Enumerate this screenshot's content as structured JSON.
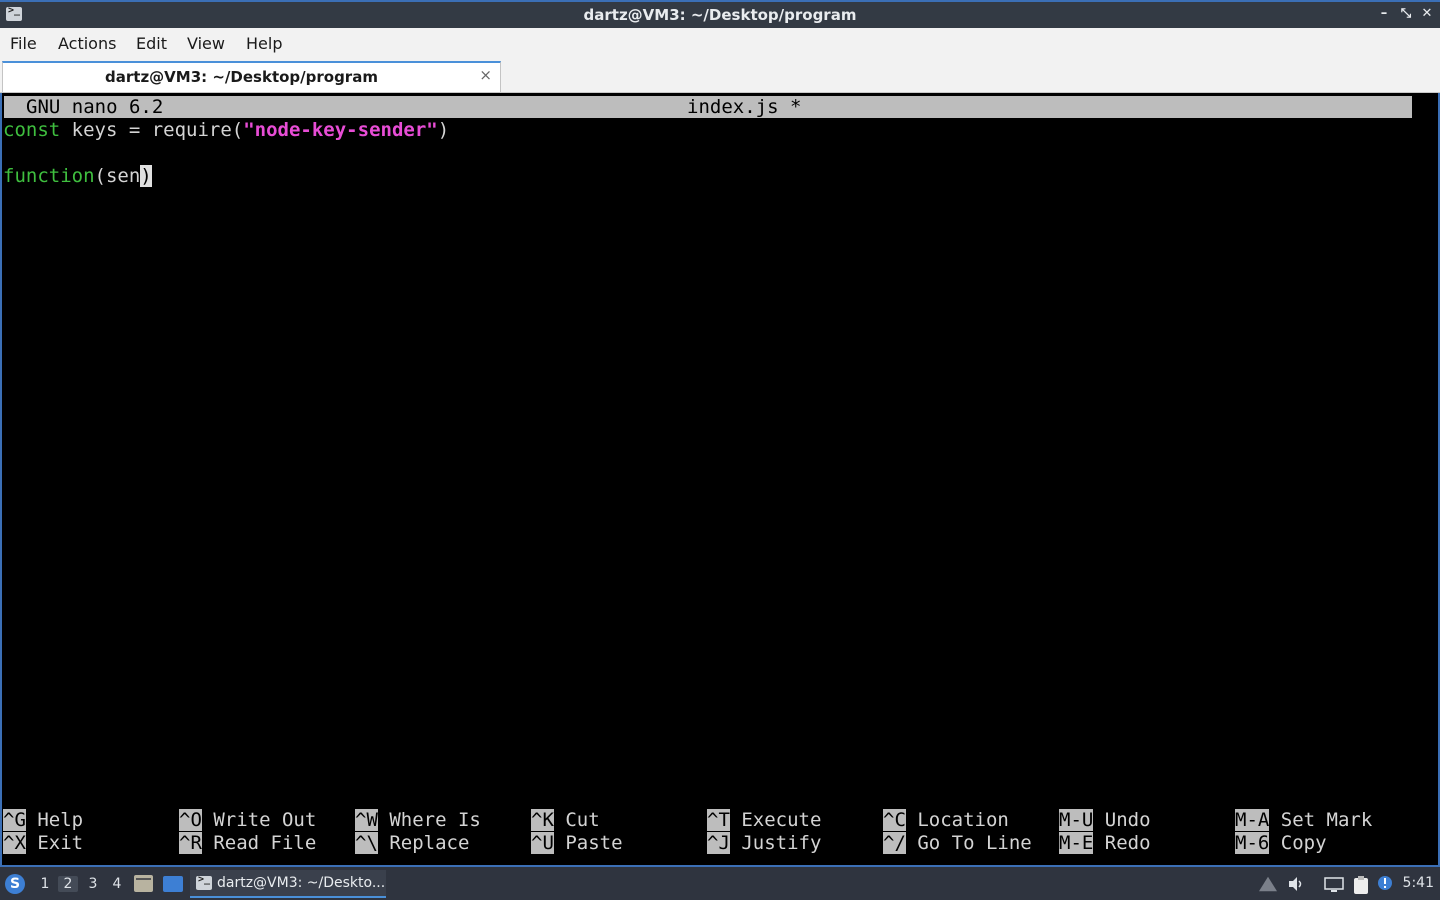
{
  "window": {
    "title": "dartz@VM3: ~/Desktop/program",
    "icon": "terminal-icon",
    "controls": [
      "minimize",
      "maximize",
      "close"
    ],
    "control_glyphs": {
      "minimize": "–",
      "maximize": "⤡",
      "close": "✕"
    }
  },
  "menubar": {
    "items": [
      "File",
      "Actions",
      "Edit",
      "View",
      "Help"
    ]
  },
  "tabs": [
    {
      "label": "dartz@VM3: ~/Desktop/program",
      "close_glyph": "×"
    }
  ],
  "nano": {
    "version": "GNU nano 6.2",
    "filename": "index.js *",
    "content": {
      "line1": {
        "kw": "const",
        "rest1": " keys = require(",
        "str": "\"node-key-sender\"",
        "rest2": ")"
      },
      "line3": {
        "kw": "function",
        "rest": "(sen",
        "cursor": ")"
      }
    },
    "shortcuts": [
      {
        "key": "^G",
        "label": "Help"
      },
      {
        "key": "^X",
        "label": "Exit"
      },
      {
        "key": "^O",
        "label": "Write Out"
      },
      {
        "key": "^R",
        "label": "Read File"
      },
      {
        "key": "^W",
        "label": "Where Is"
      },
      {
        "key": "^\\",
        "label": "Replace"
      },
      {
        "key": "^K",
        "label": "Cut"
      },
      {
        "key": "^U",
        "label": "Paste"
      },
      {
        "key": "^T",
        "label": "Execute"
      },
      {
        "key": "^J",
        "label": "Justify"
      },
      {
        "key": "^C",
        "label": "Location"
      },
      {
        "key": "^/",
        "label": "Go To Line"
      },
      {
        "key": "M-U",
        "label": "Undo"
      },
      {
        "key": "M-E",
        "label": "Redo"
      },
      {
        "key": "M-A",
        "label": "Set Mark"
      },
      {
        "key": "M-6",
        "label": "Copy"
      }
    ]
  },
  "taskbar": {
    "menu_icon": "app-menu-icon",
    "workspaces": [
      "1",
      "2",
      "3",
      "4"
    ],
    "active_workspace": "2",
    "task_label": "dartz@VM3: ~/Deskto...",
    "clock": "5:41",
    "tray_icons": [
      "network-icon",
      "volume-icon",
      "display-icon",
      "clipboard-icon",
      "update-notifier-icon"
    ]
  },
  "colors": {
    "accent": "#3b6fb6",
    "keyword": "#3fbf3f",
    "string": "#e84dd6",
    "terminal_bg": "#000000",
    "nano_bar": "#bdbdbd"
  }
}
